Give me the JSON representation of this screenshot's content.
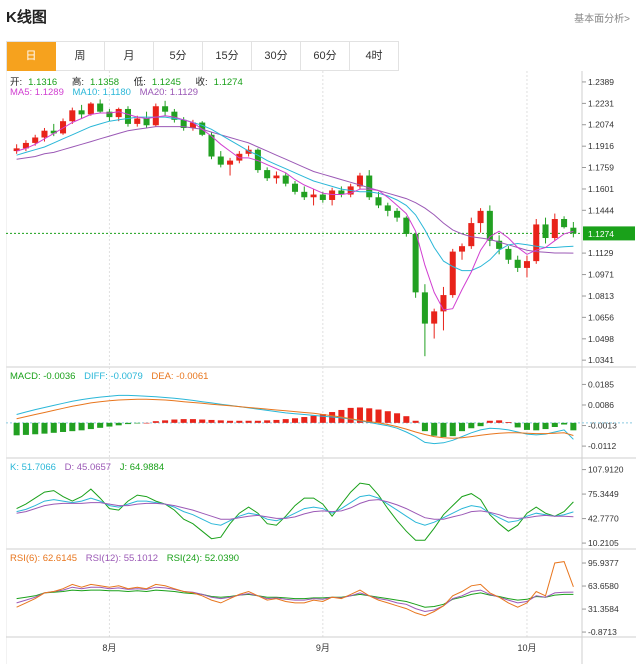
{
  "header": {
    "title": "K线图",
    "basic_link": "基本面分析>"
  },
  "tabs": [
    {
      "label": "日",
      "active": true
    },
    {
      "label": "周",
      "active": false
    },
    {
      "label": "月",
      "active": false
    },
    {
      "label": "5分",
      "active": false
    },
    {
      "label": "15分",
      "active": false
    },
    {
      "label": "30分",
      "active": false
    },
    {
      "label": "60分",
      "active": false
    },
    {
      "label": "4时",
      "active": false
    }
  ],
  "ohlc_legend": {
    "open_label": "开:",
    "open": "1.1316",
    "high_label": "高:",
    "high": "1.1358",
    "low_label": "低:",
    "low": "1.1245",
    "close_label": "收:",
    "close": "1.1274"
  },
  "ma_legend": [
    {
      "text": "MA5: 1.1289",
      "color": "#d13fd1"
    },
    {
      "text": "MA10: 1.1180",
      "color": "#2ab7d8"
    },
    {
      "text": "MA20: 1.1129",
      "color": "#9b59b6"
    }
  ],
  "macd_legend": [
    {
      "text": "MACD: -0.0036",
      "color": "#1aa11a"
    },
    {
      "text": "DIFF: -0.0079",
      "color": "#2ab7d8"
    },
    {
      "text": "DEA: -0.0061",
      "color": "#e8761e"
    }
  ],
  "kdj_legend": [
    {
      "text": "K: 51.7066",
      "color": "#2ab7d8"
    },
    {
      "text": "D: 45.0657",
      "color": "#9b59b6"
    },
    {
      "text": "J: 64.9884",
      "color": "#1aa11a"
    }
  ],
  "rsi_legend": [
    {
      "text": "RSI(6): 62.6145",
      "color": "#e8761e"
    },
    {
      "text": "RSI(12): 55.1012",
      "color": "#9b59b6"
    },
    {
      "text": "RSI(24): 52.0390",
      "color": "#1aa11a"
    }
  ],
  "current_price_label": "1.1274",
  "colors": {
    "up": "#e8231a",
    "down": "#22a022",
    "accent": "#f6a21e",
    "price_tag": "#1aa11a"
  },
  "chart_data": [
    {
      "type": "candlestick",
      "name": "price",
      "y_ticks": [
        "1.2389",
        "1.2231",
        "1.2074",
        "1.1916",
        "1.1759",
        "1.1601",
        "1.1444",
        "1.1129",
        "1.0971",
        "1.0813",
        "1.0656",
        "1.0498",
        "1.0341"
      ],
      "ylim": [
        1.032,
        1.244
      ],
      "x_ticks": [
        {
          "index": 10,
          "label": "8月"
        },
        {
          "index": 33,
          "label": "9月"
        },
        {
          "index": 55,
          "label": "10月"
        }
      ],
      "candles": [
        [
          1.188,
          1.193,
          1.186,
          1.19
        ],
        [
          1.19,
          1.196,
          1.188,
          1.194
        ],
        [
          1.194,
          1.2,
          1.192,
          1.198
        ],
        [
          1.198,
          1.205,
          1.195,
          1.203
        ],
        [
          1.203,
          1.208,
          1.199,
          1.201
        ],
        [
          1.201,
          1.212,
          1.2,
          1.21
        ],
        [
          1.21,
          1.22,
          1.208,
          1.218
        ],
        [
          1.218,
          1.222,
          1.212,
          1.215
        ],
        [
          1.215,
          1.224,
          1.214,
          1.223
        ],
        [
          1.223,
          1.226,
          1.216,
          1.217
        ],
        [
          1.217,
          1.219,
          1.21,
          1.213
        ],
        [
          1.213,
          1.22,
          1.21,
          1.219
        ],
        [
          1.219,
          1.221,
          1.206,
          1.208
        ],
        [
          1.208,
          1.214,
          1.206,
          1.212
        ],
        [
          1.212,
          1.217,
          1.205,
          1.207
        ],
        [
          1.207,
          1.223,
          1.206,
          1.221
        ],
        [
          1.221,
          1.225,
          1.214,
          1.217
        ],
        [
          1.217,
          1.219,
          1.209,
          1.211
        ],
        [
          1.211,
          1.213,
          1.203,
          1.205
        ],
        [
          1.205,
          1.211,
          1.203,
          1.209
        ],
        [
          1.209,
          1.21,
          1.199,
          1.2
        ],
        [
          1.2,
          1.202,
          1.182,
          1.184
        ],
        [
          1.184,
          1.188,
          1.176,
          1.178
        ],
        [
          1.178,
          1.183,
          1.17,
          1.181
        ],
        [
          1.181,
          1.188,
          1.179,
          1.186
        ],
        [
          1.186,
          1.192,
          1.184,
          1.189
        ],
        [
          1.189,
          1.19,
          1.172,
          1.174
        ],
        [
          1.174,
          1.176,
          1.166,
          1.168
        ],
        [
          1.168,
          1.173,
          1.164,
          1.17
        ],
        [
          1.17,
          1.172,
          1.162,
          1.164
        ],
        [
          1.164,
          1.166,
          1.156,
          1.158
        ],
        [
          1.158,
          1.162,
          1.152,
          1.154
        ],
        [
          1.154,
          1.16,
          1.148,
          1.156
        ],
        [
          1.156,
          1.158,
          1.15,
          1.152
        ],
        [
          1.152,
          1.161,
          1.148,
          1.159
        ],
        [
          1.159,
          1.162,
          1.154,
          1.156
        ],
        [
          1.156,
          1.164,
          1.154,
          1.162
        ],
        [
          1.162,
          1.172,
          1.16,
          1.17
        ],
        [
          1.17,
          1.174,
          1.152,
          1.154
        ],
        [
          1.154,
          1.158,
          1.146,
          1.148
        ],
        [
          1.148,
          1.15,
          1.14,
          1.144
        ],
        [
          1.144,
          1.146,
          1.136,
          1.139
        ],
        [
          1.139,
          1.14,
          1.125,
          1.127
        ],
        [
          1.127,
          1.128,
          1.08,
          1.084
        ],
        [
          1.084,
          1.09,
          1.037,
          1.061
        ],
        [
          1.061,
          1.072,
          1.05,
          1.07
        ],
        [
          1.07,
          1.088,
          1.056,
          1.082
        ],
        [
          1.082,
          1.116,
          1.08,
          1.114
        ],
        [
          1.114,
          1.12,
          1.108,
          1.118
        ],
        [
          1.118,
          1.139,
          1.116,
          1.135
        ],
        [
          1.135,
          1.146,
          1.128,
          1.144
        ],
        [
          1.144,
          1.148,
          1.118,
          1.122
        ],
        [
          1.122,
          1.126,
          1.112,
          1.116
        ],
        [
          1.116,
          1.118,
          1.105,
          1.108
        ],
        [
          1.108,
          1.111,
          1.099,
          1.102
        ],
        [
          1.102,
          1.111,
          1.095,
          1.107
        ],
        [
          1.107,
          1.138,
          1.105,
          1.134
        ],
        [
          1.134,
          1.139,
          1.12,
          1.124
        ],
        [
          1.124,
          1.142,
          1.122,
          1.138
        ],
        [
          1.138,
          1.14,
          1.131,
          1.132
        ],
        [
          1.1316,
          1.1358,
          1.1245,
          1.1274
        ]
      ],
      "ma5": [
        1.188,
        1.19,
        1.193,
        1.197,
        1.201,
        1.205,
        1.209,
        1.212,
        1.215,
        1.216,
        1.216,
        1.217,
        1.215,
        1.213,
        1.212,
        1.213,
        1.214,
        1.213,
        1.211,
        1.209,
        1.204,
        1.199,
        1.193,
        1.188,
        1.183,
        1.183,
        1.181,
        1.178,
        1.175,
        1.172,
        1.167,
        1.163,
        1.16,
        1.157,
        1.156,
        1.156,
        1.157,
        1.16,
        1.16,
        1.159,
        1.154,
        1.148,
        1.142,
        1.129,
        1.104,
        1.084,
        1.071,
        1.072,
        1.086,
        1.099,
        1.115,
        1.125,
        1.129,
        1.124,
        1.117,
        1.112,
        1.115,
        1.117,
        1.122,
        1.127,
        1.1289
      ],
      "ma10": [
        1.185,
        1.187,
        1.189,
        1.191,
        1.194,
        1.197,
        1.2,
        1.203,
        1.206,
        1.208,
        1.21,
        1.211,
        1.212,
        1.213,
        1.213,
        1.213,
        1.213,
        1.212,
        1.211,
        1.209,
        1.207,
        1.204,
        1.2,
        1.196,
        1.192,
        1.188,
        1.185,
        1.181,
        1.178,
        1.175,
        1.172,
        1.169,
        1.166,
        1.164,
        1.162,
        1.16,
        1.159,
        1.158,
        1.158,
        1.157,
        1.155,
        1.152,
        1.148,
        1.141,
        1.13,
        1.117,
        1.107,
        1.103,
        1.1,
        1.1,
        1.103,
        1.108,
        1.115,
        1.119,
        1.12,
        1.119,
        1.118,
        1.117,
        1.117,
        1.1175,
        1.118
      ],
      "ma20": [
        1.182,
        1.183,
        1.184,
        1.186,
        1.187,
        1.189,
        1.191,
        1.193,
        1.195,
        1.197,
        1.199,
        1.201,
        1.203,
        1.204,
        1.205,
        1.206,
        1.206,
        1.206,
        1.206,
        1.205,
        1.204,
        1.202,
        1.2,
        1.198,
        1.196,
        1.194,
        1.191,
        1.188,
        1.185,
        1.182,
        1.179,
        1.176,
        1.173,
        1.171,
        1.169,
        1.167,
        1.165,
        1.163,
        1.161,
        1.159,
        1.157,
        1.155,
        1.153,
        1.15,
        1.146,
        1.141,
        1.135,
        1.13,
        1.127,
        1.125,
        1.124,
        1.123,
        1.121,
        1.119,
        1.117,
        1.115,
        1.114,
        1.1135,
        1.113,
        1.113,
        1.1129
      ]
    },
    {
      "type": "bar+line",
      "name": "macd",
      "y_ticks": [
        "0.0185",
        "0.0086",
        "-0.0013",
        "-0.0112"
      ],
      "ylim": [
        -0.015,
        0.024
      ],
      "macd": [
        -0.006,
        -0.0058,
        -0.0055,
        -0.0052,
        -0.0048,
        -0.0044,
        -0.004,
        -0.0036,
        -0.003,
        -0.0024,
        -0.0018,
        -0.0012,
        -0.0006,
        -0.0002,
        0.0,
        0.0008,
        0.0012,
        0.0016,
        0.0018,
        0.0018,
        0.0016,
        0.0014,
        0.0012,
        0.001,
        0.001,
        0.001,
        0.001,
        0.0012,
        0.0014,
        0.0018,
        0.0022,
        0.0028,
        0.0034,
        0.0042,
        0.0052,
        0.0062,
        0.0072,
        0.0074,
        0.007,
        0.0064,
        0.0056,
        0.0046,
        0.0032,
        0.001,
        -0.004,
        -0.0062,
        -0.0068,
        -0.0064,
        -0.004,
        -0.0026,
        -0.0016,
        0.001,
        0.0012,
        0.0004,
        -0.0022,
        -0.0034,
        -0.0036,
        -0.003,
        -0.002,
        -0.0008,
        -0.0036
      ],
      "diff": [
        0.004,
        0.0052,
        0.0064,
        0.0074,
        0.0084,
        0.0094,
        0.0104,
        0.0112,
        0.0118,
        0.0124,
        0.0128,
        0.0132,
        0.0132,
        0.013,
        0.0128,
        0.0126,
        0.0122,
        0.0118,
        0.0114,
        0.0108,
        0.0102,
        0.0096,
        0.009,
        0.0084,
        0.0078,
        0.0072,
        0.0066,
        0.006,
        0.0054,
        0.0048,
        0.0044,
        0.004,
        0.0036,
        0.0032,
        0.0028,
        0.0024,
        0.0018,
        0.001,
        0.0002,
        -0.0006,
        -0.0014,
        -0.0026,
        -0.0044,
        -0.0066,
        -0.0094,
        -0.01,
        -0.0096,
        -0.0084,
        -0.0066,
        -0.0048,
        -0.0034,
        -0.0026,
        -0.0028,
        -0.0034,
        -0.0044,
        -0.0054,
        -0.0058,
        -0.0054,
        -0.0044,
        -0.0034,
        -0.0079
      ],
      "dea": [
        0.002,
        0.003,
        0.004,
        0.005,
        0.006,
        0.007,
        0.008,
        0.0088,
        0.0096,
        0.0102,
        0.0106,
        0.011,
        0.0112,
        0.0114,
        0.0114,
        0.0112,
        0.011,
        0.0106,
        0.0102,
        0.0098,
        0.0094,
        0.009,
        0.0086,
        0.0082,
        0.0078,
        0.0074,
        0.007,
        0.0066,
        0.0062,
        0.0058,
        0.0054,
        0.005,
        0.0046,
        0.004,
        0.0034,
        0.0028,
        0.002,
        0.0012,
        0.0006,
        0.0,
        -0.0008,
        -0.0018,
        -0.003,
        -0.0044,
        -0.0056,
        -0.0066,
        -0.0072,
        -0.0074,
        -0.0072,
        -0.0066,
        -0.006,
        -0.0054,
        -0.005,
        -0.0048,
        -0.0048,
        -0.005,
        -0.0052,
        -0.0052,
        -0.005,
        -0.0048,
        -0.0061
      ]
    },
    {
      "type": "line",
      "name": "kdj",
      "y_ticks": [
        "107.9120",
        "75.3449",
        "42.7770",
        "10.2105"
      ],
      "ylim": [
        5,
        118
      ],
      "k": [
        52,
        55,
        60,
        66,
        68,
        66,
        64,
        66,
        70,
        66,
        60,
        58,
        62,
        66,
        66,
        64,
        62,
        58,
        52,
        48,
        42,
        36,
        34,
        40,
        46,
        50,
        48,
        42,
        40,
        44,
        50,
        56,
        58,
        56,
        50,
        56,
        64,
        72,
        74,
        70,
        62,
        54,
        46,
        38,
        34,
        38,
        44,
        50,
        56,
        60,
        58,
        50,
        44,
        38,
        40,
        46,
        50,
        48,
        46,
        48,
        51.7
      ],
      "d": [
        50,
        52,
        56,
        60,
        62,
        63,
        63,
        63,
        64,
        64,
        62,
        60,
        60,
        62,
        63,
        63,
        62,
        60,
        57,
        54,
        50,
        46,
        42,
        42,
        44,
        46,
        47,
        45,
        43,
        43,
        45,
        49,
        52,
        53,
        52,
        53,
        57,
        63,
        67,
        68,
        65,
        61,
        56,
        50,
        44,
        42,
        42,
        45,
        48,
        52,
        53,
        51,
        48,
        44,
        43,
        44,
        46,
        47,
        46,
        46,
        45.1
      ],
      "j": [
        56,
        62,
        70,
        78,
        80,
        72,
        66,
        72,
        82,
        70,
        56,
        54,
        66,
        74,
        72,
        66,
        62,
        54,
        42,
        36,
        26,
        16,
        18,
        36,
        50,
        58,
        50,
        36,
        34,
        46,
        60,
        70,
        70,
        62,
        46,
        62,
        78,
        90,
        88,
        74,
        56,
        40,
        26,
        14,
        14,
        30,
        48,
        60,
        72,
        76,
        68,
        48,
        36,
        26,
        34,
        50,
        58,
        50,
        46,
        52,
        65.0
      ]
    },
    {
      "type": "line",
      "name": "rsi",
      "y_ticks": [
        "95.9377",
        "63.6580",
        "31.3584",
        "-0.8713"
      ],
      "ylim": [
        -5,
        110
      ],
      "rsi6": [
        34,
        40,
        46,
        54,
        56,
        60,
        66,
        62,
        66,
        64,
        62,
        64,
        60,
        62,
        60,
        66,
        64,
        60,
        56,
        54,
        50,
        44,
        40,
        46,
        52,
        56,
        50,
        44,
        46,
        42,
        40,
        40,
        44,
        42,
        48,
        46,
        52,
        58,
        50,
        44,
        40,
        36,
        32,
        26,
        22,
        28,
        36,
        50,
        56,
        64,
        66,
        54,
        48,
        40,
        34,
        40,
        56,
        50,
        96,
        98,
        62.6
      ],
      "rsi12": [
        40,
        44,
        48,
        54,
        56,
        58,
        62,
        60,
        62,
        62,
        60,
        61,
        59,
        60,
        59,
        62,
        61,
        59,
        56,
        55,
        52,
        48,
        46,
        48,
        51,
        53,
        50,
        46,
        47,
        45,
        44,
        44,
        46,
        45,
        48,
        47,
        50,
        54,
        50,
        46,
        44,
        40,
        38,
        32,
        28,
        30,
        36,
        46,
        50,
        56,
        58,
        52,
        48,
        44,
        40,
        42,
        50,
        48,
        54,
        55,
        55.1
      ],
      "rsi24": [
        46,
        48,
        50,
        54,
        55,
        56,
        58,
        57,
        58,
        58,
        57,
        57,
        56,
        57,
        56,
        58,
        57,
        56,
        54,
        53,
        52,
        49,
        48,
        49,
        51,
        52,
        50,
        48,
        48,
        47,
        46,
        46,
        47,
        47,
        48,
        48,
        50,
        52,
        50,
        48,
        46,
        44,
        42,
        38,
        34,
        35,
        38,
        45,
        48,
        52,
        54,
        51,
        49,
        46,
        44,
        45,
        49,
        48,
        51,
        52,
        52.0
      ]
    }
  ]
}
